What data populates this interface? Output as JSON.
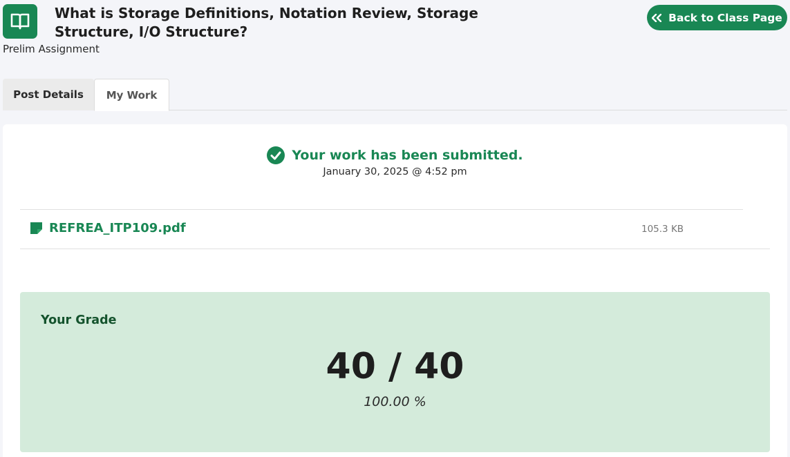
{
  "header": {
    "title": "What is Storage Definitions, Notation Review, Storage Structure, I/O Structure?",
    "subtitle": "Prelim Assignment",
    "icon": "open-book-icon",
    "back_button_label": "Back to Class Page",
    "back_button_icon": "double-chevron-left-icon"
  },
  "tabs": [
    {
      "label": "Post Details",
      "active": false
    },
    {
      "label": "My Work",
      "active": true
    }
  ],
  "submission": {
    "status_text": "Your work has been submitted.",
    "status_icon": "check-circle-icon",
    "submitted_at": "January 30, 2025 @ 4:52 pm",
    "file": {
      "name": "REFREA_ITP109.pdf",
      "size": "105.3 KB",
      "icon": "file-icon"
    }
  },
  "grade": {
    "label": "Your Grade",
    "score": "40 / 40",
    "percent": "100.00 %"
  },
  "colors": {
    "accent": "#198754",
    "grade_background": "#d4ebdb",
    "grade_label": "#14532d"
  }
}
